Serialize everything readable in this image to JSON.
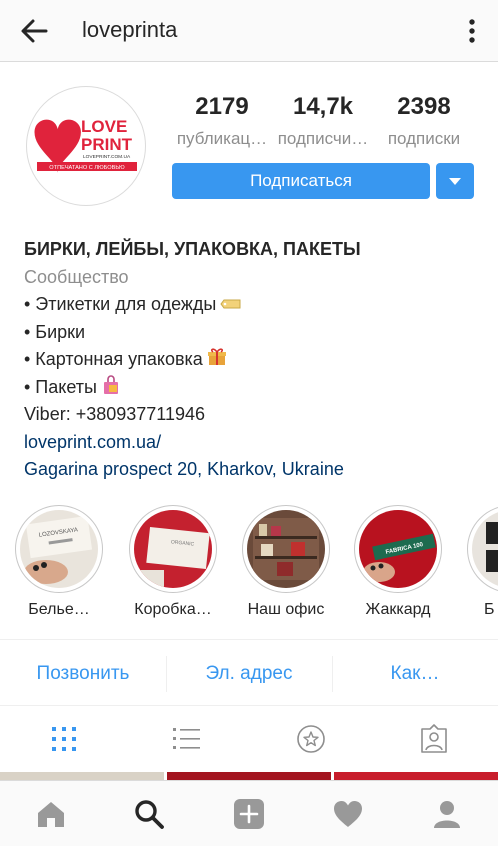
{
  "header": {
    "username": "loveprinta",
    "back_icon": "arrow-left-icon",
    "menu_icon": "more-vertical-icon"
  },
  "avatar": {
    "logo_line1": "LOVE",
    "logo_line2": "PRINT",
    "logo_url": "LOVEPRINT.COM.UA",
    "logo_banner": "ОТПЕЧАТАНО С ЛЮБОВЬЮ"
  },
  "stats": [
    {
      "value": "2179",
      "label": "публикац…"
    },
    {
      "value": "14,7k",
      "label": "подписчи…"
    },
    {
      "value": "2398",
      "label": "подписки"
    }
  ],
  "follow_button": {
    "label": "Подписаться"
  },
  "bio": {
    "name": "БИРКИ, ЛЕЙБЫ, УПАКОВКА, ПАКЕТЫ",
    "category": "Сообщество",
    "lines": [
      "• Этикетки для одежды",
      "• Бирки",
      "• Картонная упаковка",
      "• Пакеты"
    ],
    "phone": "Viber: +380937711946",
    "website": "loveprint.com.ua/",
    "address": "Gagarina prospect 20, Kharkov, Ukraine"
  },
  "highlights": [
    {
      "label": "Белье…",
      "tag": "LOZOVSKAYA"
    },
    {
      "label": "Коробка…",
      "tag": "ORGANIC"
    },
    {
      "label": "Наш офис"
    },
    {
      "label": "Жаккард",
      "tag": "FABRICA 100"
    },
    {
      "label": "Б"
    }
  ],
  "actions": {
    "call": "Позвонить",
    "email": "Эл. адрес",
    "directions": "Как…"
  },
  "tabs": [
    "grid-icon",
    "list-icon",
    "star-icon",
    "tagged-icon"
  ],
  "bottom_nav": [
    "home-icon",
    "search-icon",
    "add-icon",
    "heart-icon",
    "profile-icon"
  ],
  "colors": {
    "accent": "#3897f0",
    "link": "#003569",
    "secondary_text": "#8e8e8e",
    "logo_red": "#e0233c"
  }
}
